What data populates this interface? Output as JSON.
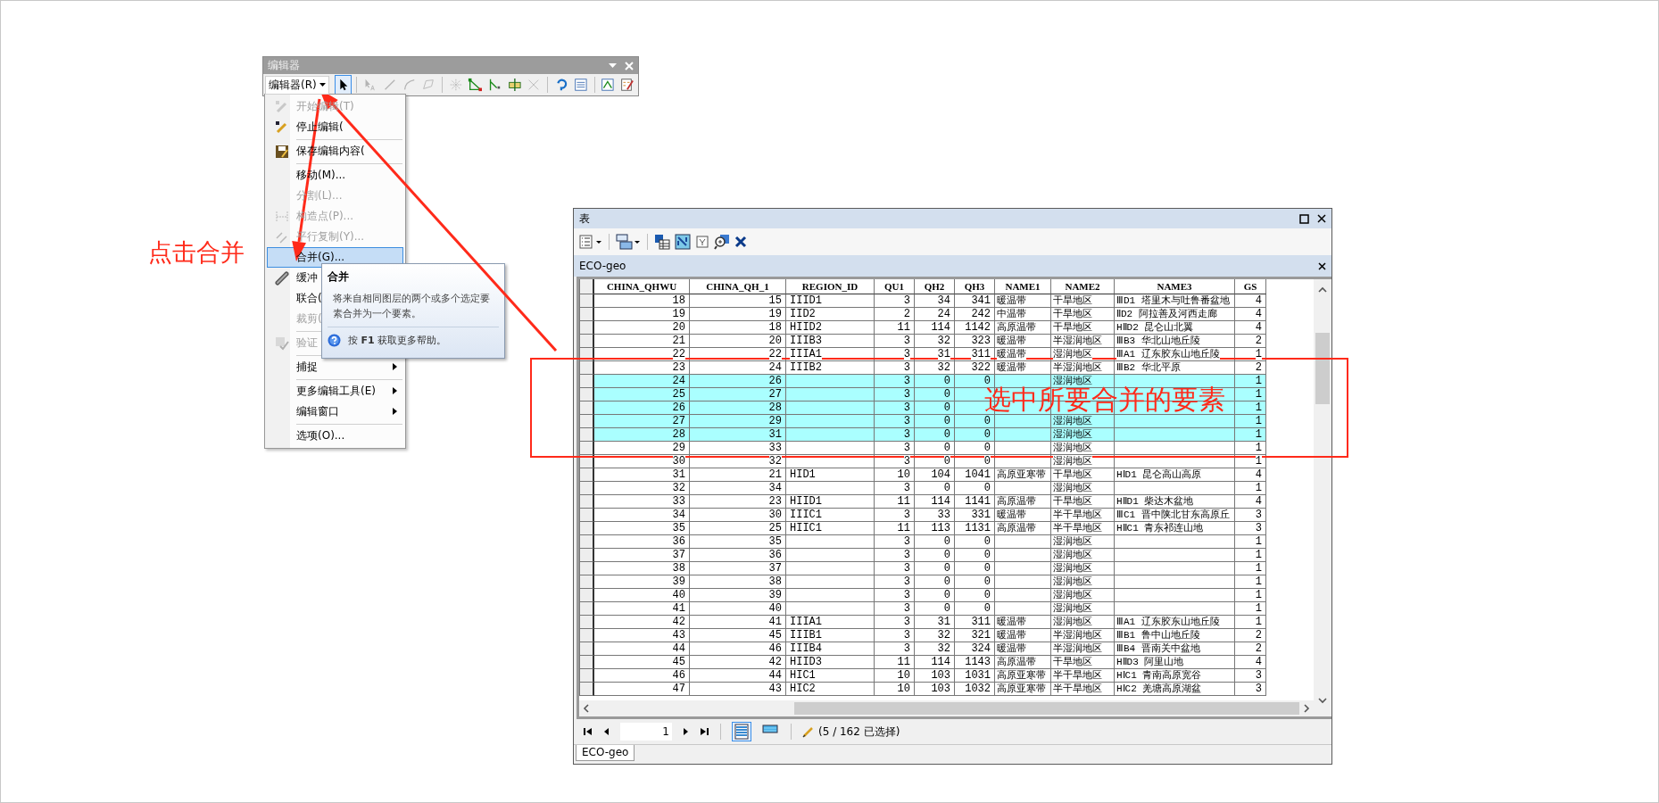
{
  "editor_toolbar": {
    "title": "编辑器",
    "menu_button": "编辑器(R)",
    "tools": [
      {
        "selected": true,
        "disabled": false
      },
      {
        "selected": false,
        "disabled": true
      },
      {
        "selected": false,
        "disabled": true
      },
      {
        "selected": false,
        "disabled": true
      },
      {
        "selected": false,
        "disabled": true
      },
      {
        "selected": false,
        "disabled": true
      },
      {
        "selected": false,
        "disabled": false
      },
      {
        "selected": false,
        "disabled": false
      },
      {
        "selected": false,
        "disabled": false
      },
      {
        "selected": false,
        "disabled": true
      },
      {
        "selected": false,
        "disabled": false
      },
      {
        "selected": false,
        "disabled": false
      },
      {
        "selected": false,
        "disabled": false
      },
      {
        "selected": false,
        "disabled": false
      }
    ]
  },
  "editor_menu": [
    {
      "label": "开始编辑(T)",
      "disabled": true,
      "selected": false,
      "submenu": false,
      "separator_before": false
    },
    {
      "label": "停止编辑(",
      "disabled": false,
      "selected": false,
      "submenu": false,
      "separator_before": false
    },
    {
      "label": "保存编辑内容(",
      "disabled": false,
      "selected": false,
      "submenu": false,
      "separator_before": true
    },
    {
      "label": "移动(M)...",
      "disabled": false,
      "selected": false,
      "submenu": false,
      "separator_before": true
    },
    {
      "label": "分割(L)...",
      "disabled": true,
      "selected": false,
      "submenu": false,
      "separator_before": false
    },
    {
      "label": "构造点(P)...",
      "disabled": true,
      "selected": false,
      "submenu": false,
      "separator_before": false
    },
    {
      "label": "平行复制(Y)...",
      "disabled": true,
      "selected": false,
      "submenu": false,
      "separator_before": false
    },
    {
      "label": "合并(G)...",
      "disabled": false,
      "selected": true,
      "submenu": false,
      "separator_before": false
    },
    {
      "label": "缓冲",
      "disabled": false,
      "selected": false,
      "separator_before": false
    },
    {
      "label": "联合(",
      "disabled": false,
      "selected": false,
      "separator_before": false
    },
    {
      "label": "裁剪(",
      "disabled": true,
      "selected": false,
      "separator_before": false
    },
    {
      "label": "验证",
      "disabled": true,
      "selected": false,
      "separator_before": true
    },
    {
      "label": "捕捉",
      "disabled": false,
      "selected": false,
      "submenu": true,
      "separator_before": true
    },
    {
      "label": "更多编辑工具(E)",
      "disabled": false,
      "selected": false,
      "submenu": true,
      "separator_before": true
    },
    {
      "label": "编辑窗口",
      "disabled": false,
      "selected": false,
      "submenu": true,
      "separator_before": false
    },
    {
      "label": "选项(O)...",
      "disabled": false,
      "selected": false,
      "submenu": false,
      "separator_before": true
    }
  ],
  "tooltip": {
    "title": "合并",
    "body": "将来自相同图层的两个或多个选定要素合并为一个要素。",
    "help": "按 **F1** 获取更多帮助。"
  },
  "table_window": {
    "title": "表",
    "layer_tab": "ECO-geo",
    "columns": [
      "CHINA_QHWU",
      "CHINA_QH_1",
      "REGION_ID",
      "QU1",
      "QH2",
      "QH3",
      "NAME1",
      "NAME2",
      "NAME3",
      "GS"
    ],
    "rows": [
      {
        "selected": false,
        "cells": [
          "18",
          "15",
          "IIID1",
          "3",
          "34",
          "341",
          "暖温带",
          "干旱地区",
          "ⅢD1 塔里木与吐鲁番盆地",
          "4"
        ]
      },
      {
        "selected": false,
        "cells": [
          "19",
          "19",
          "IID2",
          "2",
          "24",
          "242",
          "中温带",
          "干旱地区",
          "ⅡD2 阿拉善及河西走廊",
          "4"
        ]
      },
      {
        "selected": false,
        "cells": [
          "20",
          "18",
          "HIID2",
          "11",
          "114",
          "1142",
          "高原温带",
          "干旱地区",
          "HⅡD2 昆仑山北翼",
          "4"
        ]
      },
      {
        "selected": false,
        "cells": [
          "21",
          "20",
          "IIIB3",
          "3",
          "32",
          "323",
          "暖温带",
          "半湿润地区",
          "ⅢB3 华北山地丘陵",
          "2"
        ]
      },
      {
        "selected": false,
        "cells": [
          "22",
          "22",
          "IIIA1",
          "3",
          "31",
          "311",
          "暖温带",
          "湿润地区",
          "ⅢA1 辽东胶东山地丘陵",
          "1"
        ]
      },
      {
        "selected": false,
        "cells": [
          "23",
          "24",
          "IIIB2",
          "3",
          "32",
          "322",
          "暖温带",
          "半湿润地区",
          "ⅢB2 华北平原",
          "2"
        ]
      },
      {
        "selected": true,
        "cells": [
          "24",
          "26",
          null,
          "3",
          "0",
          "0",
          null,
          "湿润地区",
          null,
          "1"
        ]
      },
      {
        "selected": true,
        "cells": [
          "25",
          "27",
          null,
          "3",
          "0",
          null,
          null,
          null,
          null,
          "1"
        ]
      },
      {
        "selected": true,
        "cells": [
          "26",
          "28",
          null,
          "3",
          "0",
          null,
          null,
          null,
          null,
          "1"
        ]
      },
      {
        "selected": true,
        "cells": [
          "27",
          "29",
          null,
          "3",
          "0",
          "0",
          null,
          "湿润地区",
          null,
          "1"
        ]
      },
      {
        "selected": true,
        "cells": [
          "28",
          "31",
          null,
          "3",
          "0",
          "0",
          null,
          "湿润地区",
          null,
          "1"
        ]
      },
      {
        "selected": false,
        "cells": [
          "29",
          "33",
          null,
          "3",
          "0",
          "0",
          null,
          "湿润地区",
          null,
          "1"
        ]
      },
      {
        "selected": false,
        "cells": [
          "30",
          "32",
          null,
          "3",
          "0",
          "0",
          null,
          "湿润地区",
          null,
          "1"
        ]
      },
      {
        "selected": false,
        "cells": [
          "31",
          "21",
          "HID1",
          "10",
          "104",
          "1041",
          "高原亚寒带",
          "干旱地区",
          "HⅠD1 昆仑高山高原",
          "4"
        ]
      },
      {
        "selected": false,
        "cells": [
          "32",
          "34",
          null,
          "3",
          "0",
          "0",
          null,
          "湿润地区",
          null,
          "1"
        ]
      },
      {
        "selected": false,
        "cells": [
          "33",
          "23",
          "HIID1",
          "11",
          "114",
          "1141",
          "高原温带",
          "干旱地区",
          "HⅡD1 柴达木盆地",
          "4"
        ]
      },
      {
        "selected": false,
        "cells": [
          "34",
          "30",
          "IIIC1",
          "3",
          "33",
          "331",
          "暖温带",
          "半干旱地区",
          "ⅢC1 晋中陕北甘东高原丘",
          "3"
        ]
      },
      {
        "selected": false,
        "cells": [
          "35",
          "25",
          "HIIC1",
          "11",
          "113",
          "1131",
          "高原温带",
          "半干旱地区",
          "HⅡC1 青东祁连山地",
          "3"
        ]
      },
      {
        "selected": false,
        "cells": [
          "36",
          "35",
          null,
          "3",
          "0",
          "0",
          null,
          "湿润地区",
          null,
          "1"
        ]
      },
      {
        "selected": false,
        "cells": [
          "37",
          "36",
          null,
          "3",
          "0",
          "0",
          null,
          "湿润地区",
          null,
          "1"
        ]
      },
      {
        "selected": false,
        "cells": [
          "38",
          "37",
          null,
          "3",
          "0",
          "0",
          null,
          "湿润地区",
          null,
          "1"
        ]
      },
      {
        "selected": false,
        "cells": [
          "39",
          "38",
          null,
          "3",
          "0",
          "0",
          null,
          "湿润地区",
          null,
          "1"
        ]
      },
      {
        "selected": false,
        "cells": [
          "40",
          "39",
          null,
          "3",
          "0",
          "0",
          null,
          "湿润地区",
          null,
          "1"
        ]
      },
      {
        "selected": false,
        "cells": [
          "41",
          "40",
          null,
          "3",
          "0",
          "0",
          null,
          "湿润地区",
          null,
          "1"
        ]
      },
      {
        "selected": false,
        "cells": [
          "42",
          "41",
          "IIIA1",
          "3",
          "31",
          "311",
          "暖温带",
          "湿润地区",
          "ⅢA1 辽东胶东山地丘陵",
          "1"
        ]
      },
      {
        "selected": false,
        "cells": [
          "43",
          "45",
          "IIIB1",
          "3",
          "32",
          "321",
          "暖温带",
          "半湿润地区",
          "ⅢB1 鲁中山地丘陵",
          "2"
        ]
      },
      {
        "selected": false,
        "cells": [
          "44",
          "46",
          "IIIB4",
          "3",
          "32",
          "324",
          "暖温带",
          "半湿润地区",
          "ⅢB4 晋南关中盆地",
          "2"
        ]
      },
      {
        "selected": false,
        "cells": [
          "45",
          "42",
          "HIID3",
          "11",
          "114",
          "1143",
          "高原温带",
          "干旱地区",
          "HⅡD3 阿里山地",
          "4"
        ]
      },
      {
        "selected": false,
        "cells": [
          "46",
          "44",
          "HIC1",
          "10",
          "103",
          "1031",
          "高原亚寒带",
          "半干旱地区",
          "HⅠC1 青南高原宽谷",
          "3"
        ]
      },
      {
        "selected": false,
        "cells": [
          "47",
          "43",
          "HIC2",
          "10",
          "103",
          "1032",
          "高原亚寒带",
          "半干旱地区",
          "HⅠC2 羌塘高原湖盆",
          "3"
        ]
      }
    ],
    "page": "1",
    "views": [
      {
        "selected": true
      },
      {
        "selected": false
      }
    ],
    "status": "(5 / 162 已选择)",
    "bottom_tab": "ECO-geo"
  },
  "annotations": [
    {
      "text": "点击合并"
    },
    {
      "text": "选中所要合并的要素"
    }
  ]
}
